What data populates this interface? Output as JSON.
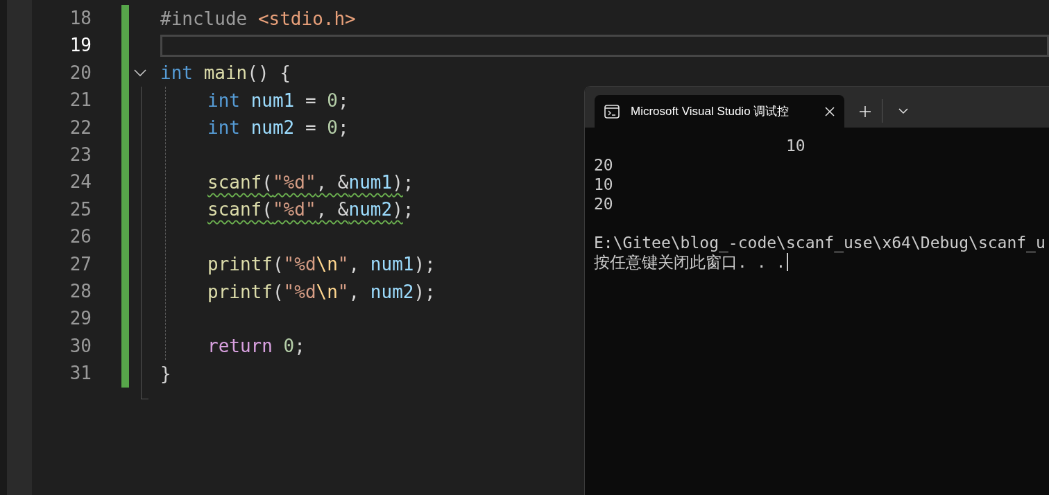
{
  "editor": {
    "lines": [
      {
        "number": "18",
        "current": false,
        "tokens": [
          {
            "kind": "preproc",
            "text": "#include "
          },
          {
            "kind": "header",
            "text": "<stdio.h>"
          }
        ]
      },
      {
        "number": "19",
        "current": true
      },
      {
        "number": "20",
        "current": false,
        "expanded": true,
        "tokens": [
          {
            "kind": "keyword",
            "text": "int "
          },
          {
            "kind": "func",
            "text": "main"
          },
          {
            "kind": "plain",
            "text": "() {"
          }
        ],
        "children": [
          {
            "number": "21",
            "current": false,
            "tokens": [
              {
                "kind": "keyword",
                "text": "int "
              },
              {
                "kind": "var",
                "text": "num1"
              },
              {
                "kind": "plain",
                "text": " = "
              },
              {
                "kind": "number",
                "text": "0"
              },
              {
                "kind": "plain",
                "text": ";"
              }
            ]
          },
          {
            "number": "22",
            "current": false,
            "tokens": [
              {
                "kind": "keyword",
                "text": "int "
              },
              {
                "kind": "var",
                "text": "num2"
              },
              {
                "kind": "plain",
                "text": " = "
              },
              {
                "kind": "number",
                "text": "0"
              },
              {
                "kind": "plain",
                "text": ";"
              }
            ]
          },
          {
            "number": "23",
            "current": false
          },
          {
            "number": "24",
            "current": false,
            "segments": [
              {
                "squiggle": true,
                "tokens": [
                  {
                    "kind": "func",
                    "text": "scanf"
                  },
                  {
                    "kind": "plain",
                    "text": "("
                  },
                  {
                    "kind": "string",
                    "text": "\"%d\""
                  },
                  {
                    "kind": "plain",
                    "text": ", &"
                  },
                  {
                    "kind": "var",
                    "text": "num1"
                  },
                  {
                    "kind": "plain",
                    "text": ")"
                  }
                ]
              },
              {
                "squiggle": false,
                "tokens": [
                  {
                    "kind": "plain",
                    "text": ";"
                  }
                ]
              }
            ]
          },
          {
            "number": "25",
            "current": false,
            "segments": [
              {
                "squiggle": true,
                "tokens": [
                  {
                    "kind": "func",
                    "text": "scanf"
                  },
                  {
                    "kind": "plain",
                    "text": "("
                  },
                  {
                    "kind": "string",
                    "text": "\"%d\""
                  },
                  {
                    "kind": "plain",
                    "text": ", &"
                  },
                  {
                    "kind": "var",
                    "text": "num2"
                  },
                  {
                    "kind": "plain",
                    "text": ")"
                  }
                ]
              },
              {
                "squiggle": false,
                "tokens": [
                  {
                    "kind": "plain",
                    "text": ";"
                  }
                ]
              }
            ]
          },
          {
            "number": "26",
            "current": false
          },
          {
            "number": "27",
            "current": false,
            "tokens": [
              {
                "kind": "func",
                "text": "printf"
              },
              {
                "kind": "plain",
                "text": "("
              },
              {
                "kind": "string",
                "text": "\"%d"
              },
              {
                "kind": "escape",
                "text": "\\n"
              },
              {
                "kind": "string",
                "text": "\""
              },
              {
                "kind": "plain",
                "text": ", "
              },
              {
                "kind": "var",
                "text": "num1"
              },
              {
                "kind": "plain",
                "text": ");"
              }
            ]
          },
          {
            "number": "28",
            "current": false,
            "tokens": [
              {
                "kind": "func",
                "text": "printf"
              },
              {
                "kind": "plain",
                "text": "("
              },
              {
                "kind": "string",
                "text": "\"%d"
              },
              {
                "kind": "escape",
                "text": "\\n"
              },
              {
                "kind": "string",
                "text": "\""
              },
              {
                "kind": "plain",
                "text": ", "
              },
              {
                "kind": "var",
                "text": "num2"
              },
              {
                "kind": "plain",
                "text": ");"
              }
            ]
          },
          {
            "number": "29",
            "current": false
          },
          {
            "number": "30",
            "current": false,
            "tokens": [
              {
                "kind": "control",
                "text": "return "
              },
              {
                "kind": "number",
                "text": "0"
              },
              {
                "kind": "plain",
                "text": ";"
              }
            ]
          }
        ]
      },
      {
        "number": "31",
        "current": false,
        "tokens": [
          {
            "kind": "plain",
            "text": "}"
          }
        ]
      }
    ]
  },
  "console": {
    "tab": {
      "title": "Microsoft Visual Studio 调试控",
      "selected": true
    },
    "lines": [
      {
        "kind": "output",
        "text": "                    10"
      },
      {
        "kind": "output",
        "text": "20"
      },
      {
        "kind": "output",
        "text": "10"
      },
      {
        "kind": "output",
        "text": "20"
      },
      {
        "kind": "blank"
      },
      {
        "kind": "output",
        "text": "E:\\Gitee\\blog_-code\\scanf_use\\x64\\Debug\\scanf_u"
      },
      {
        "kind": "output",
        "text": "按任意键关闭此窗口. . .",
        "cursor": true
      }
    ]
  }
}
